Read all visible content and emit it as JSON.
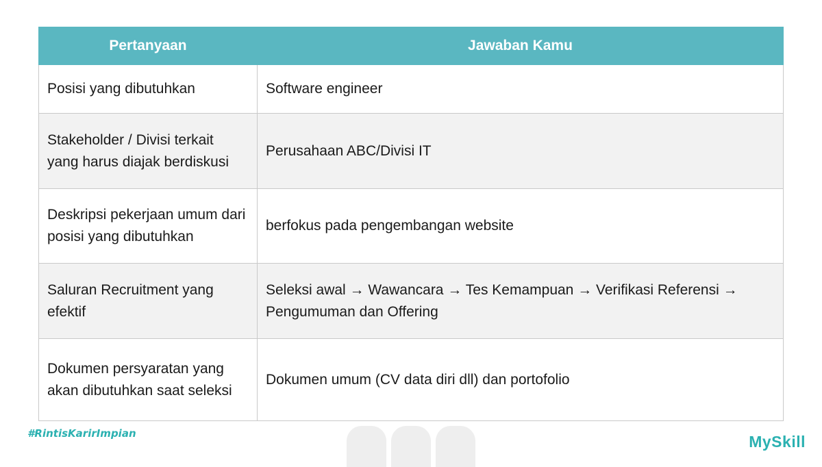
{
  "table": {
    "headers": [
      "Pertanyaan",
      "Jawaban Kamu"
    ],
    "rows": [
      {
        "question": "Posisi yang dibutuhkan",
        "answer": "Software engineer"
      },
      {
        "question": "Stakeholder / Divisi terkait yang harus diajak berdiskusi",
        "answer": "Perusahaan ABC/Divisi IT"
      },
      {
        "question": "Deskripsi pekerjaan umum dari posisi yang dibutuhkan",
        "answer": "berfokus pada pengembangan website"
      },
      {
        "question": "Saluran Recruitment yang efektif",
        "answer": "Seleksi awal → Wawancara → Tes Kemampuan → Verifikasi Referensi → Pengumuman dan Offering"
      },
      {
        "question": "Dokumen persyaratan yang akan dibutuhkan saat seleksi",
        "answer": "Dokumen umum (CV data diri dll) dan portofolio"
      }
    ]
  },
  "footer": {
    "hashtag": "#RintisKarirImpian",
    "brand": "MySkill"
  },
  "colors": {
    "header_bg": "#5ab7c1",
    "accent": "#2bb1b1",
    "row_alt": "#f2f2f2"
  }
}
